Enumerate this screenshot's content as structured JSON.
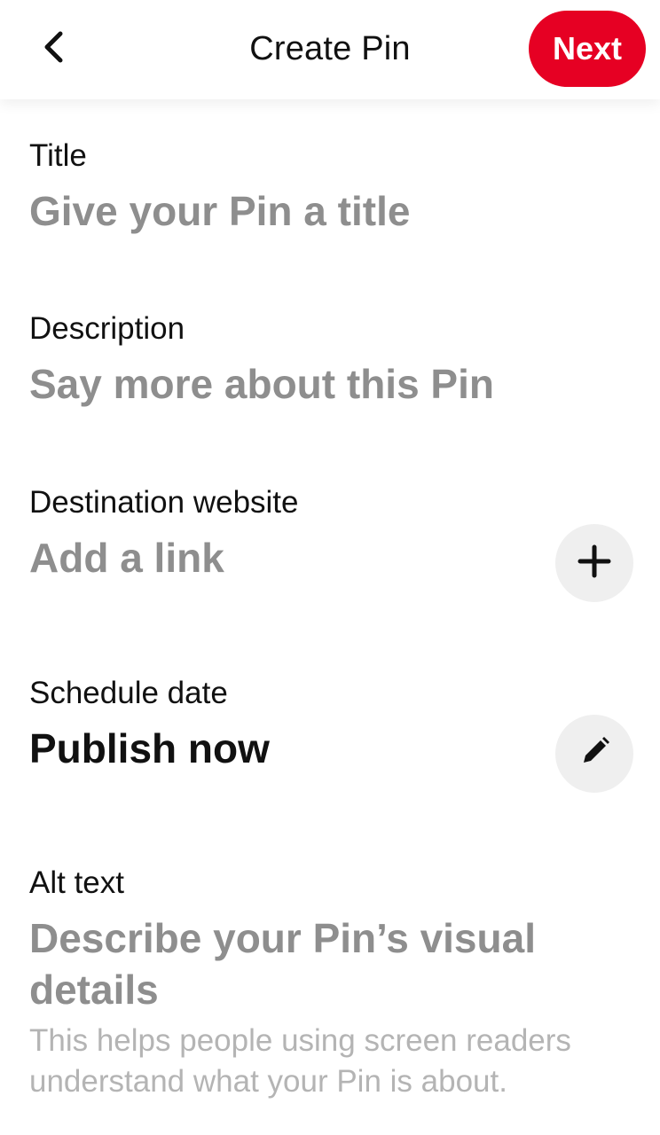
{
  "header": {
    "title": "Create Pin",
    "next_label": "Next",
    "back_icon": "chevron-left-icon"
  },
  "colors": {
    "accent": "#e60023",
    "placeholder": "#8e8e8e",
    "helper": "#b4b4b4",
    "icon_button_bg": "#efefef"
  },
  "form": {
    "title": {
      "label": "Title",
      "placeholder": "Give your Pin a title"
    },
    "description": {
      "label": "Description",
      "placeholder": "Say more about this Pin"
    },
    "destination": {
      "label": "Destination website",
      "placeholder": "Add a link",
      "button_icon": "plus-icon"
    },
    "schedule": {
      "label": "Schedule date",
      "value": "Publish now",
      "button_icon": "pencil-icon"
    },
    "alt_text": {
      "label": "Alt text",
      "placeholder": "Describe your Pin’s visual details",
      "helper": "This helps people using screen readers understand what your Pin is about."
    }
  }
}
